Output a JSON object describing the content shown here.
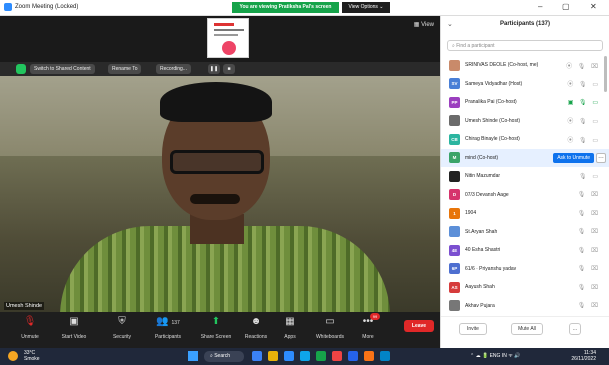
{
  "titlebar": {
    "app_title": "Zoom Meeting (Locked)",
    "viewing_banner": "You are viewing Pratiksha Pal's screen",
    "view_options": "View Options ⌄",
    "minimize": "–",
    "maximize": "▢",
    "close": "✕"
  },
  "share": {
    "view_label": "▦ View",
    "strip": {
      "switch_label": "Switch to Shared Content",
      "rename_label": "Rename To",
      "recording_label": "Recording..."
    }
  },
  "video": {
    "name_tag": "Umesh Shinde"
  },
  "controls": {
    "unmute": "Unmute",
    "start_video": "Start Video",
    "security": "Security",
    "participants": "Participants",
    "participants_count": "137",
    "share_screen": "Share Screen",
    "reactions": "Reactions",
    "apps": "Apps",
    "whiteboards": "Whiteboards",
    "more": "More",
    "more_badge": "99",
    "leave": "Leave"
  },
  "panel": {
    "title": "Participants (137)",
    "search_placeholder": "Find a participant",
    "ask_to_unmute": "Ask to Unmute",
    "participants": [
      {
        "initials": "",
        "name": "SRINIVAS DEOLE (Co-host, me)",
        "color": "#c98a6a",
        "photo": true,
        "icons": "⦿ 🎙 ⌧",
        "muted": true
      },
      {
        "initials": "SV",
        "name": "Sameya Vidyadhar (Host)",
        "color": "#4a7fd6",
        "photo": false,
        "icons": "⦿ 🎙 ▭",
        "muted": false
      },
      {
        "initials": "PP",
        "name": "Pranalika Pai (Co-host)",
        "color": "#9b3fbf",
        "photo": false,
        "icons": "▣ 🎙 ▭",
        "muted": false,
        "green": true
      },
      {
        "initials": "",
        "name": "Umesh Shinde (Co-host)",
        "color": "#6b6b6b",
        "photo": true,
        "icons": "⦿ 🎙 ▭",
        "muted": false
      },
      {
        "initials": "CB",
        "name": "Chirag Binayle (Co-host)",
        "color": "#2bb5a0",
        "photo": false,
        "icons": "⦿ 🎙 ▭",
        "muted": false
      },
      {
        "initials": "M",
        "name": "mind (Co-host)",
        "color": "#3aa46a",
        "photo": false,
        "icons": "",
        "muted": false,
        "active": true
      },
      {
        "initials": "",
        "name": "Nitin Mazumdar",
        "color": "#222222",
        "photo": true,
        "icons": "🎙 ▭",
        "muted": false
      },
      {
        "initials": "D",
        "name": "07/3 Devansh Aage",
        "color": "#d6336c",
        "photo": false,
        "icons": "🎙 ⌧",
        "muted": true
      },
      {
        "initials": "1",
        "name": "1904",
        "color": "#e8750a",
        "photo": false,
        "icons": "🎙 ⌧",
        "muted": true
      },
      {
        "initials": "",
        "name": "St.Aryan Shah",
        "color": "#5c8fd8",
        "photo": true,
        "icons": "🎙 ⌧",
        "muted": true
      },
      {
        "initials": "4E",
        "name": "40 Esha Shastri",
        "color": "#7b4fd0",
        "photo": false,
        "icons": "🎙 ⌧",
        "muted": true
      },
      {
        "initials": "6P",
        "name": "61/6 · Priyanshu yadav",
        "color": "#4e6fd0",
        "photo": false,
        "icons": "🎙 ⌧",
        "muted": true
      },
      {
        "initials": "AS",
        "name": "Aayush Shah",
        "color": "#d63c3c",
        "photo": false,
        "icons": "🎙 ⌧",
        "muted": true
      },
      {
        "initials": "",
        "name": "Akhav Pujara",
        "color": "#777777",
        "photo": true,
        "icons": "🎙 ⌧",
        "muted": true
      }
    ],
    "footer": {
      "invite": "Invite",
      "mute_all": "Mute All",
      "more": "..."
    }
  },
  "taskbar": {
    "temp": "33°C",
    "weather": "Smoke",
    "search": "Search",
    "lang": "ENG IN",
    "time": "11:34",
    "date": "26/11/2022"
  }
}
